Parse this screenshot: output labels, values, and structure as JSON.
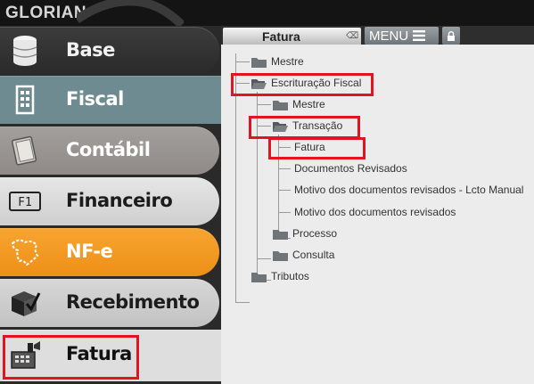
{
  "app": {
    "logo": "GLORIAN"
  },
  "sidebar": {
    "items": [
      {
        "label": "Base",
        "icon": "database-icon"
      },
      {
        "label": "Fiscal",
        "icon": "building-icon"
      },
      {
        "label": "Contábil",
        "icon": "book-icon"
      },
      {
        "label": "Financeiro",
        "icon": "f1-key-icon"
      },
      {
        "label": "NF-e",
        "icon": "map-icon"
      },
      {
        "label": "Recebimento",
        "icon": "box-check-icon"
      },
      {
        "label": "Fatura",
        "icon": "cash-register-icon"
      }
    ],
    "selected": "Fatura"
  },
  "panel": {
    "tab_label": "Fatura",
    "menu_label": "MENU"
  },
  "tree": {
    "mestre": "Mestre",
    "escrituracao": "Escrituração Fiscal",
    "esc_mestre": "Mestre",
    "transacao": "Transação",
    "fatura": "Fatura",
    "documentos_revisados": "Documentos Revisados",
    "motivo_lcto": "Motivo dos documentos revisados - Lcto Manual",
    "motivo": "Motivo dos documentos revisados",
    "processo": "Processo",
    "consulta": "Consulta",
    "tributos": "Tributos"
  },
  "colors": {
    "highlight": "#e3141f",
    "nfe": "#f39a22",
    "fiscal": "#6e8b91"
  }
}
